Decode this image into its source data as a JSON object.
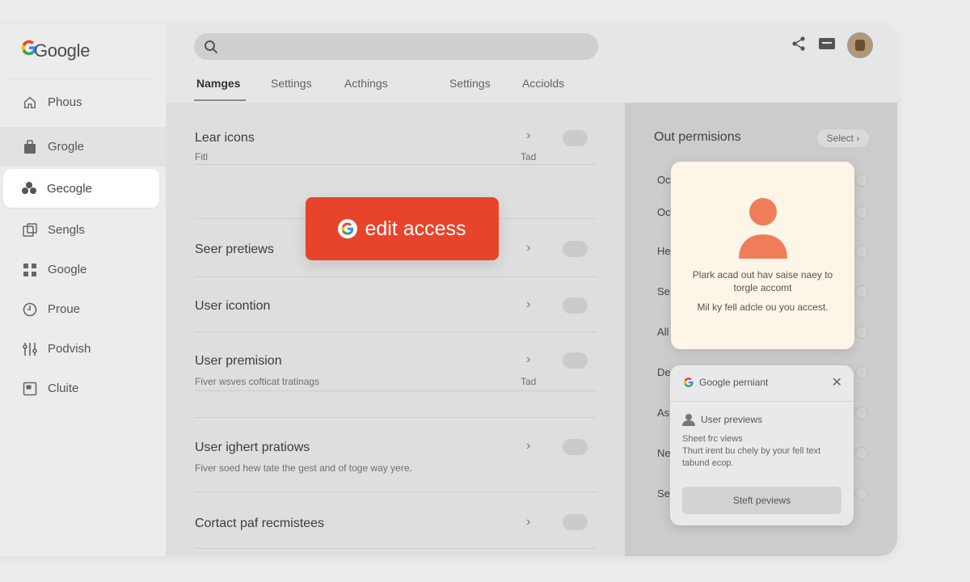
{
  "app": {
    "brand": "Google"
  },
  "sidebar": {
    "items": [
      {
        "label": "Phous",
        "icon": "home-icon"
      },
      {
        "label": "Grogle",
        "icon": "bag-icon"
      },
      {
        "label": "Gecogle",
        "icon": "people-icon"
      },
      {
        "label": "Sengls",
        "icon": "layout-icon"
      },
      {
        "label": "Google",
        "icon": "grid-icon"
      },
      {
        "label": "Proue",
        "icon": "clock-icon"
      },
      {
        "label": "Podvish",
        "icon": "sliders-icon"
      },
      {
        "label": "Cluite",
        "icon": "window-icon"
      }
    ]
  },
  "header": {
    "tabs": [
      "Namges",
      "Settings",
      "Acthings",
      "Settings",
      "Acciolds"
    ],
    "active_tab": 0
  },
  "main": {
    "rows": [
      {
        "title": "Lear icons",
        "sub": "Fitl",
        "meta": "Tad"
      },
      {
        "title": "Seer pretiews",
        "sub": "",
        "meta": ""
      },
      {
        "title": "User icontion",
        "sub": "",
        "meta": ""
      },
      {
        "title": "User premision",
        "sub": "Fiver wsves cofticat tratinags",
        "meta": "Tad"
      },
      {
        "title": "User ighert pratiows",
        "sub": "Fiver soed hew tate the gest and of toge way yere.",
        "meta": ""
      },
      {
        "title": "Cortact paf recmistees",
        "sub": "",
        "meta": ""
      }
    ],
    "edit_badge": "edit access"
  },
  "right_panel": {
    "title": "Out permisions",
    "select_label": "Select",
    "letters": [
      "Oc",
      "Oc",
      "He",
      "Se",
      "All",
      "De",
      "As",
      "Ne",
      "Se"
    ]
  },
  "perm_card": {
    "text1": "Plark acad out hav saise naey to torgle accomt",
    "text2": "Mil ky fell adcle ou you accest."
  },
  "dialog": {
    "title": "Google perniant",
    "item": "User previews",
    "desc1": "Sheet frc views",
    "desc2": "Thurt irent bu chely by your fell text tabund ecop.",
    "button": "Steft peviews"
  },
  "colors": {
    "accent_red": "#e8432b",
    "card_bg": "#fdf5e7",
    "person_orange": "#f07d5a"
  }
}
